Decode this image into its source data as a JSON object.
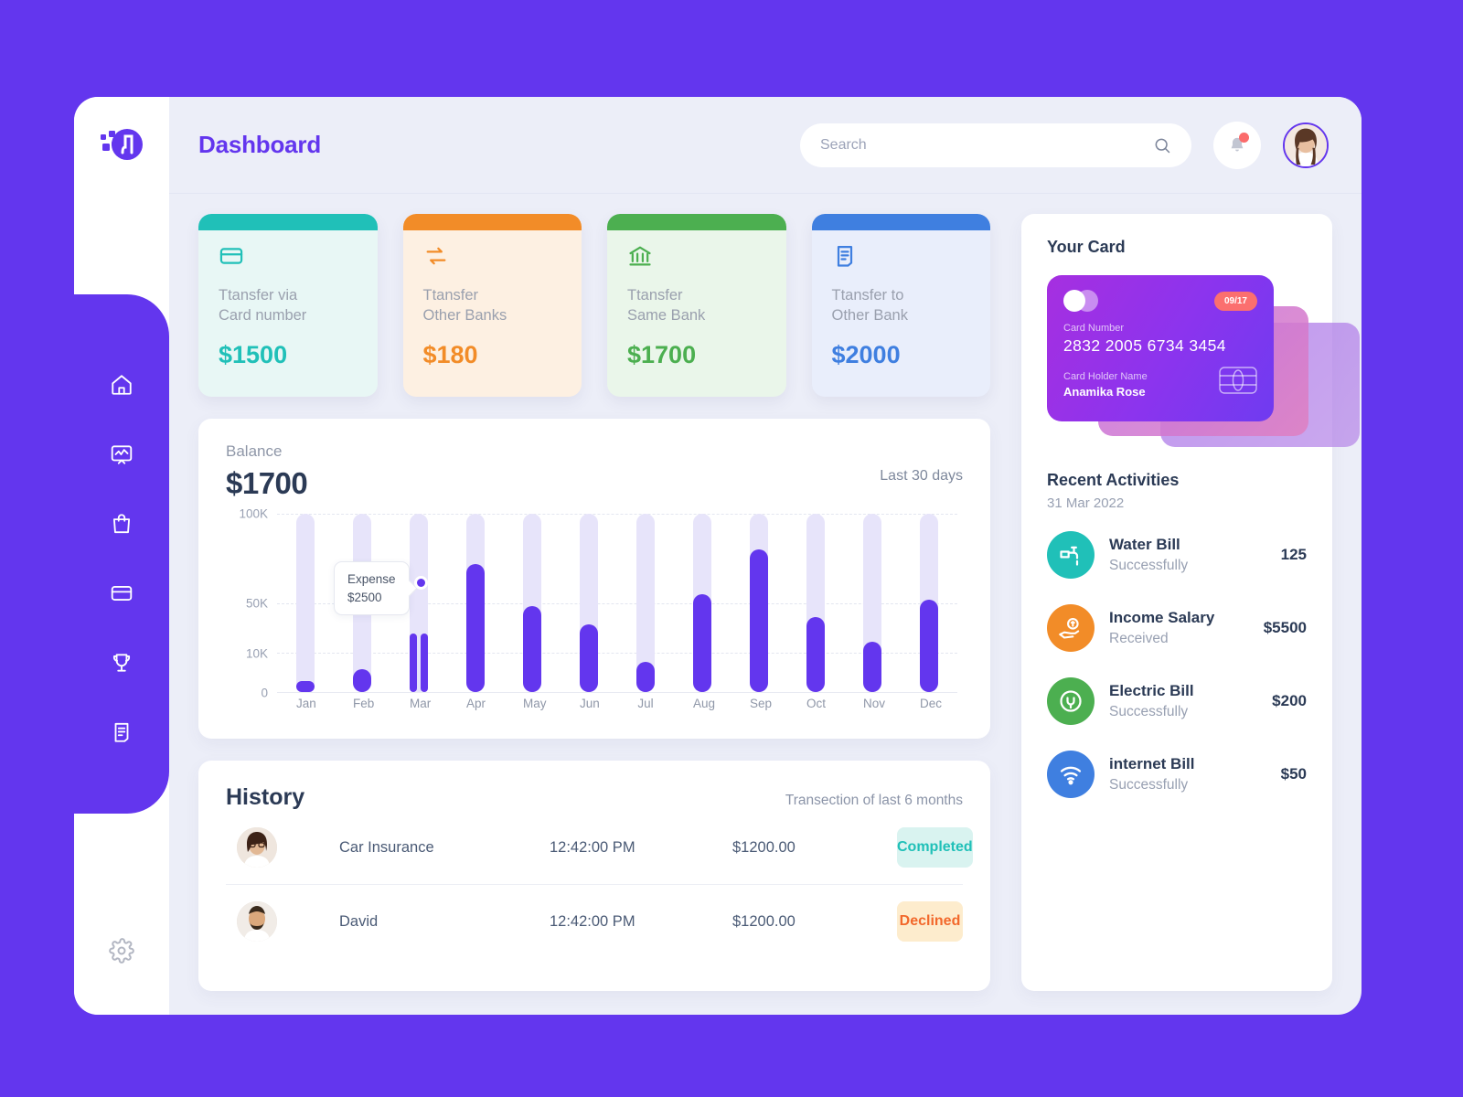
{
  "theme": {
    "bg_purple": "#6336ee",
    "window_bg": "#eceef8",
    "teal": "#20c0b8",
    "orange": "#f28c28",
    "green": "#4caf50",
    "blue": "#3f7fe0",
    "dark_text": "#2b3a55"
  },
  "sidebar": {
    "logo_name": "app-logo",
    "items": [
      {
        "name": "home-icon",
        "label": "Home"
      },
      {
        "name": "analytics-icon",
        "label": "Analytics"
      },
      {
        "name": "shopping-bag-icon",
        "label": "Shopping"
      },
      {
        "name": "credit-card-icon",
        "label": "Cards"
      },
      {
        "name": "trophy-icon",
        "label": "Rewards"
      },
      {
        "name": "invoice-icon",
        "label": "Invoices"
      }
    ],
    "settings": {
      "name": "gear-icon",
      "label": "Settings"
    }
  },
  "header": {
    "title": "Dashboard",
    "search": {
      "placeholder": "Search",
      "value": "",
      "icon": "search-icon"
    },
    "notification": {
      "icon": "bell-icon",
      "has_unread": true
    },
    "avatar": {
      "name": "user-avatar"
    }
  },
  "stat_cards": [
    {
      "label": "Ttansfer via\nCard number",
      "value": "$1500",
      "color": "#20c0b8",
      "bg": "#e8f7f5",
      "icon": "credit-card-icon"
    },
    {
      "label": "Ttansfer\nOther Banks",
      "value": "$180",
      "color": "#f28c28",
      "bg": "#fdf0e2",
      "icon": "transfer-arrows-icon"
    },
    {
      "label": "Ttansfer\nSame Bank",
      "value": "$1700",
      "color": "#4caf50",
      "bg": "#eaf6ea",
      "icon": "bank-icon"
    },
    {
      "label": "Ttansfer to\nOther Bank",
      "value": "$2000",
      "color": "#3f7fe0",
      "bg": "#e9eefb",
      "icon": "receipt-icon"
    }
  ],
  "balance": {
    "label": "Balance",
    "value": "$1700",
    "period": "Last 30 days",
    "tooltip": {
      "title": "Expense",
      "amount": "$2500"
    }
  },
  "chart_data": {
    "type": "bar",
    "title": "Balance",
    "xlabel": "",
    "ylabel": "",
    "categories": [
      "Jan",
      "Feb",
      "Mar",
      "Apr",
      "May",
      "Jun",
      "Jul",
      "Aug",
      "Sep",
      "Oct",
      "Nov",
      "Dec"
    ],
    "values": [
      6,
      13,
      33,
      72,
      48,
      38,
      17,
      55,
      80,
      42,
      28,
      52
    ],
    "track_max": 100,
    "ytick_labels": [
      "100K",
      "50K",
      "10K",
      "0"
    ],
    "ytick_positions": [
      100,
      50,
      22,
      0
    ],
    "ylim": [
      0,
      100
    ],
    "grid": true,
    "legend": null,
    "series": [
      {
        "name": "Balance",
        "values": [
          6,
          13,
          33,
          72,
          48,
          38,
          17,
          55,
          80,
          42,
          28,
          52
        ]
      }
    ],
    "annotations": [
      {
        "label": "Expense",
        "value": "$2500",
        "at_category": "Mar",
        "y": 45
      }
    ],
    "split_bar_category": "Mar",
    "bar_color": "#6336ee",
    "track_color": "#e7e4fa"
  },
  "history": {
    "title": "History",
    "subtitle": "Transection of last 6 months",
    "rows": [
      {
        "avatar": "woman-avatar",
        "name": "Car Insurance",
        "time": "12:42:00 PM",
        "amount": "$1200.00",
        "status": "Completed",
        "status_color": "#20c0b8",
        "status_bg": "#d9f3f0"
      },
      {
        "avatar": "man-avatar",
        "name": "David",
        "time": "12:42:00 PM",
        "amount": "$1200.00",
        "status": "Declined",
        "status_color": "#f2682b",
        "status_bg": "#fdeccd"
      }
    ]
  },
  "your_card": {
    "title": "Your Card",
    "expiry": "09/17",
    "card_number_label": "Card Number",
    "card_number": "2832 2005 6734 3454",
    "holder_label": "Card Holder Name",
    "holder_name": "Anamika Rose"
  },
  "recent_activities": {
    "title": "Recent Activities",
    "date": "31 Mar 2022",
    "items": [
      {
        "name": "Water Bill",
        "status": "Successfully",
        "amount": "125",
        "color": "#20c0b8",
        "icon": "water-tap-icon"
      },
      {
        "name": "Income Salary",
        "status": "Received",
        "amount": "$5500",
        "color": "#f28c28",
        "icon": "salary-hand-icon"
      },
      {
        "name": "Electric Bill",
        "status": "Successfully",
        "amount": "$200",
        "color": "#4caf50",
        "icon": "power-plug-icon"
      },
      {
        "name": "internet Bill",
        "status": "Successfully",
        "amount": "$50",
        "color": "#3f7fe0",
        "icon": "wifi-icon"
      }
    ]
  }
}
